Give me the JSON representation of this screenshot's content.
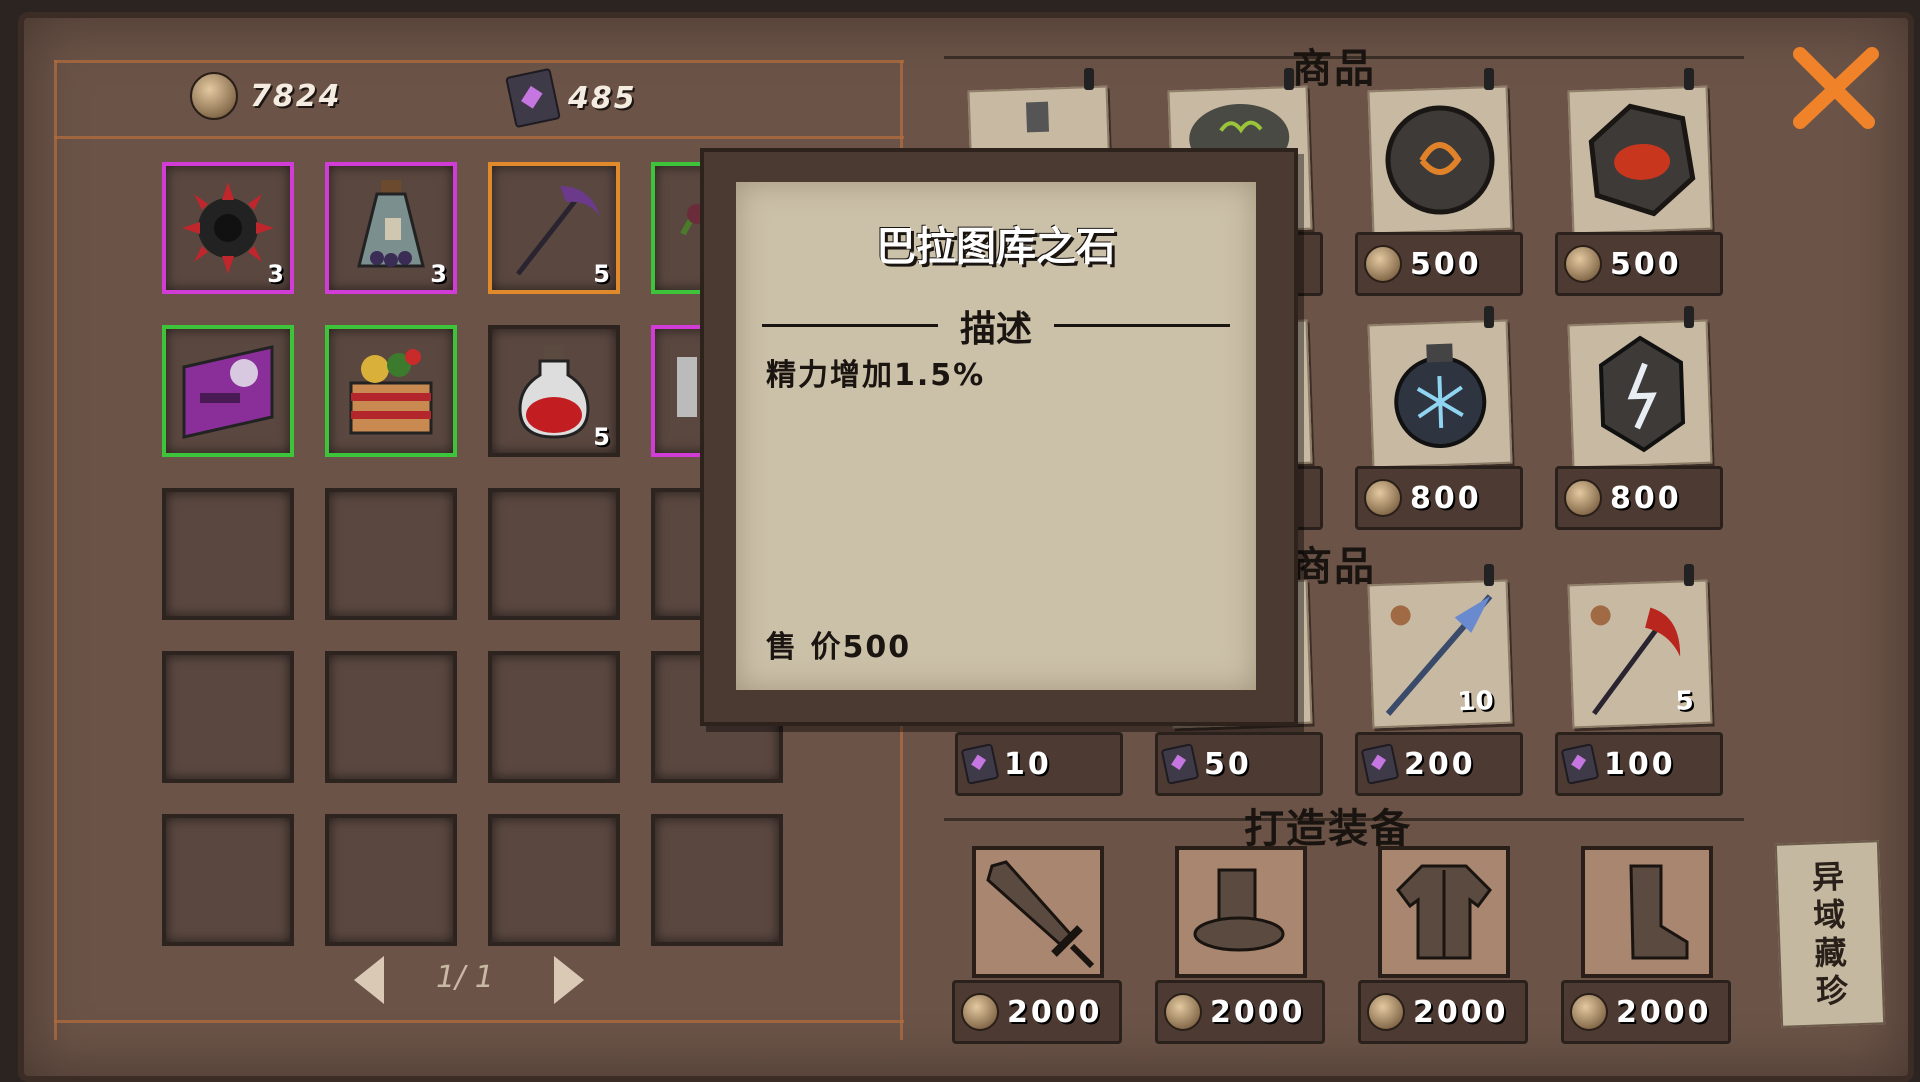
{
  "currency": {
    "coins": "7824",
    "gems": "485"
  },
  "inventory": {
    "slots": [
      {
        "rarity": "purple",
        "icon": "spiked-bomb-icon",
        "count": "3"
      },
      {
        "rarity": "purple",
        "icon": "potion-jar-icon",
        "count": "3"
      },
      {
        "rarity": "orange",
        "icon": "scythe-icon",
        "count": "5"
      },
      {
        "rarity": "green",
        "icon": "plant-icon",
        "count": ""
      },
      {
        "rarity": "green",
        "icon": "scroll-icon",
        "count": ""
      },
      {
        "rarity": "green",
        "icon": "bells-icon",
        "count": ""
      },
      {
        "rarity": "none",
        "icon": "red-potion-icon",
        "count": "5"
      },
      {
        "rarity": "purple",
        "icon": "flask-icon",
        "count": ""
      }
    ],
    "pagination": "1/ 1"
  },
  "shop": {
    "section_goods_1": "商品",
    "section_goods_2": "商品",
    "section_craft": "打造装备",
    "goods_row1": [
      {
        "icon": "potion-bottle-icon",
        "price": ""
      },
      {
        "icon": "moss-stone-icon",
        "price": ""
      },
      {
        "icon": "rune-stone-icon",
        "price": "500"
      },
      {
        "icon": "demon-stone-icon",
        "price": "500"
      }
    ],
    "goods_row2": [
      {
        "icon": "",
        "price": ""
      },
      {
        "icon": "",
        "price": ""
      },
      {
        "icon": "ice-grenade-icon",
        "price": "800"
      },
      {
        "icon": "lightning-stone-icon",
        "price": "800"
      }
    ],
    "goods_row3": [
      {
        "icon": "",
        "price": "10",
        "count": ""
      },
      {
        "icon": "",
        "price": "50",
        "count": ""
      },
      {
        "icon": "crystal-spear-icon",
        "price": "200",
        "count": "10"
      },
      {
        "icon": "blood-scythe-icon",
        "price": "100",
        "count": "5"
      }
    ],
    "craft": [
      {
        "icon": "sword-icon",
        "price": "2000"
      },
      {
        "icon": "hat-icon",
        "price": "2000"
      },
      {
        "icon": "coat-icon",
        "price": "2000"
      },
      {
        "icon": "boot-icon",
        "price": "2000"
      }
    ],
    "side_tab": "异域藏珍"
  },
  "tooltip": {
    "title": "巴拉图库之石",
    "heading": "描述",
    "description": "精力增加1.5%",
    "sell_label": "售 价",
    "sell_price": "500"
  },
  "colors": {
    "purple": "#d23cd6",
    "orange": "#e08a2c",
    "green": "#3ec43a",
    "close": "#f0822a"
  }
}
